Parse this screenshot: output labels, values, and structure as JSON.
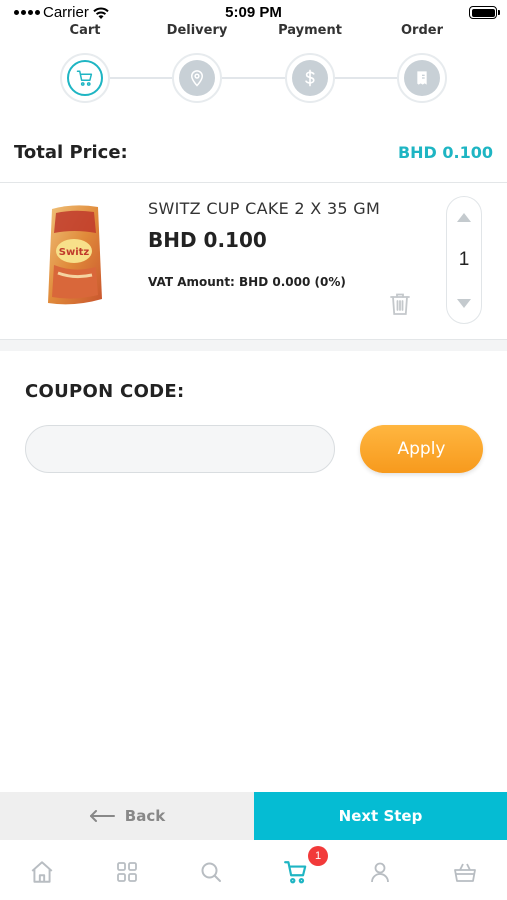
{
  "status_bar": {
    "carrier": "Carrier",
    "time": "5:09 PM"
  },
  "steps": [
    {
      "label": "Cart",
      "icon": "cart-icon",
      "active": true
    },
    {
      "label": "Delivery",
      "icon": "location-pin-icon",
      "active": false
    },
    {
      "label": "Payment",
      "icon": "dollar-icon",
      "active": false
    },
    {
      "label": "Order",
      "icon": "receipt-icon",
      "active": false
    }
  ],
  "total": {
    "label": "Total Price:",
    "value": "BHD 0.100"
  },
  "cart_item": {
    "name": "SWITZ CUP CAKE 2 X 35 GM",
    "price": "BHD 0.100",
    "vat": "VAT Amount: BHD 0.000 (0%)",
    "quantity": "1"
  },
  "coupon": {
    "title": "COUPON CODE:",
    "placeholder": "",
    "value": "",
    "apply_label": "Apply"
  },
  "nav_buttons": {
    "back_label": "Back",
    "next_label": "Next Step"
  },
  "tab_bar": {
    "items": [
      "home-icon",
      "grid-icon",
      "search-icon",
      "cart-icon",
      "user-icon",
      "basket-icon"
    ],
    "cart_badge": "1"
  },
  "colors": {
    "accent": "#1eb5c3",
    "next_button": "#05bcd3",
    "apply_button": "#f79a1d",
    "badge": "#f23a3a"
  }
}
